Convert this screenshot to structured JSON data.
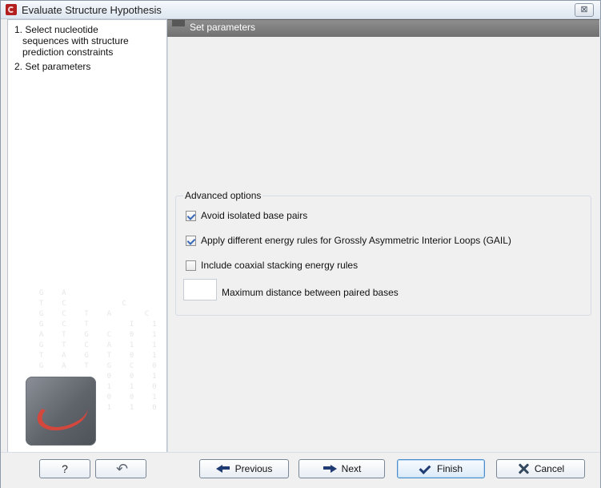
{
  "window": {
    "title": "Evaluate Structure Hypothesis",
    "close_glyph": "⊠"
  },
  "sidebar": {
    "steps": [
      {
        "line1": "1. Select nucleotide",
        "line2": "sequences with structure",
        "line3": "prediction constraints"
      },
      {
        "line1": "2. Set parameters"
      }
    ],
    "background_matrix": "\n  G  A\n  T  C       C\n  G  C  T  A    C\n  G  C  T     I  1\n  A  T  G  C  0  1\n  G  T  C  A  1  1  0\n  T  A  G  T  0  1  1\n  G  A  T  G  C  0  1\n           0  0  1\n           1  1  0\n           0  0  1\n           1  1  0",
    "logo_name": "app-logo"
  },
  "header": {
    "title": "Set parameters"
  },
  "advanced_options": {
    "title": "Advanced options",
    "options": [
      {
        "label": "Avoid isolated base pairs",
        "checked": true
      },
      {
        "label": "Apply different energy rules for Grossly Asymmetric Interior Loops (GAIL)",
        "checked": true
      },
      {
        "label": "Include coaxial stacking energy rules",
        "checked": false
      }
    ],
    "max_distance": {
      "value": "",
      "label": "Maximum distance between paired bases"
    }
  },
  "footer": {
    "help_label": "?",
    "reset_label": "",
    "previous_label": "Previous",
    "next_label": "Next",
    "finish_label": "Finish",
    "cancel_label": "Cancel"
  },
  "icons": {
    "app": "app-icon",
    "close": "close-icon",
    "help": "help-icon",
    "reset": "reset-icon",
    "previous": "arrow-left-icon",
    "next": "arrow-right-icon",
    "finish": "check-icon",
    "cancel": "cancel-icon"
  },
  "colors": {
    "titlebar": "#dde6f0",
    "header": "#7a7a7a",
    "window_bg": "#f0f0f0",
    "primary_button_border": "#4f8dca",
    "checkbox_check": "#3768b8"
  }
}
